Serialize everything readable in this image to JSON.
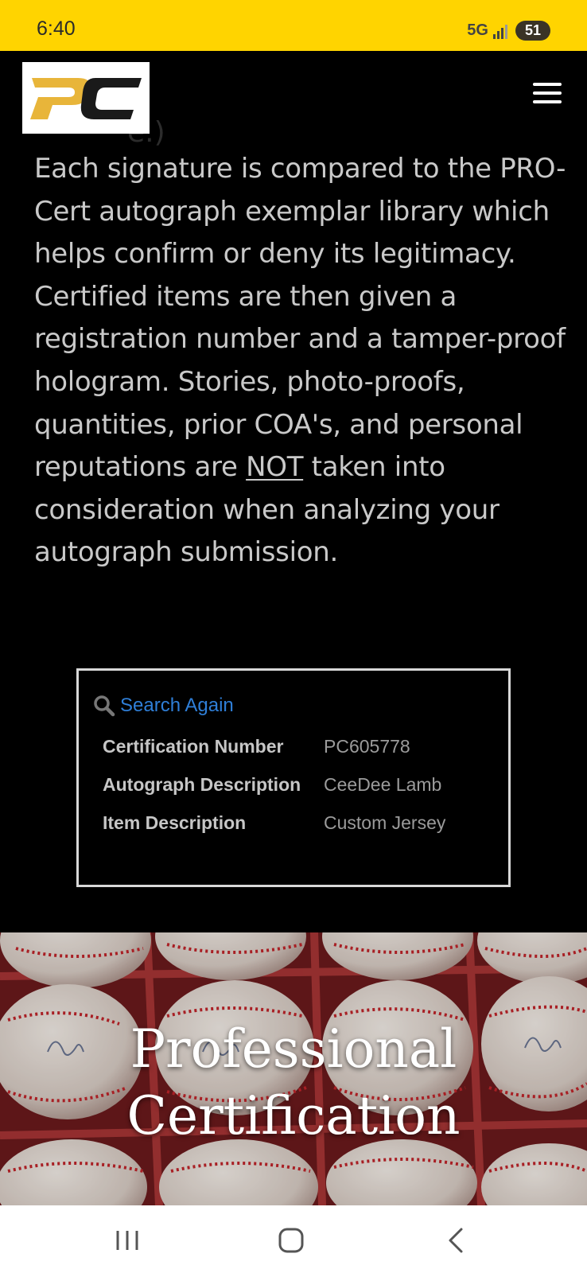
{
  "status_bar": {
    "time": "6:40",
    "network": "5G",
    "battery": "51",
    "background": "#FFD400"
  },
  "header": {
    "logo_text": "PC",
    "ghost_text": "e.)",
    "menu_icon": "hamburger-menu-icon"
  },
  "intro": {
    "text_before": "Each signature is compared to the PRO-Cert autograph exemplar library which helps confirm or deny its legitimacy. Certified items are then given a registration number and a tamper-proof hologram. Stories, photo-proofs, quantities, prior COA's, and personal reputations are ",
    "emphasis": "NOT",
    "text_after": " taken into consideration when analyzing your autograph submission."
  },
  "certificate": {
    "search_again_label": "Search Again",
    "search_icon": "search-icon",
    "rows": [
      {
        "label": "Certification Number",
        "value": "PC605778"
      },
      {
        "label": "Autograph Description",
        "value": "CeeDee Lamb"
      },
      {
        "label": "Item Description",
        "value": "Custom Jersey"
      }
    ]
  },
  "hero": {
    "title_line1": "Professional",
    "title_line2": "Certification"
  },
  "nav_bar": {
    "recents_icon": "recents-icon",
    "home_icon": "home-icon",
    "back_icon": "back-icon"
  },
  "colors": {
    "accent_yellow": "#FFD400",
    "link_blue": "#2f7fd8",
    "logo_gold": "#E8B53A"
  }
}
